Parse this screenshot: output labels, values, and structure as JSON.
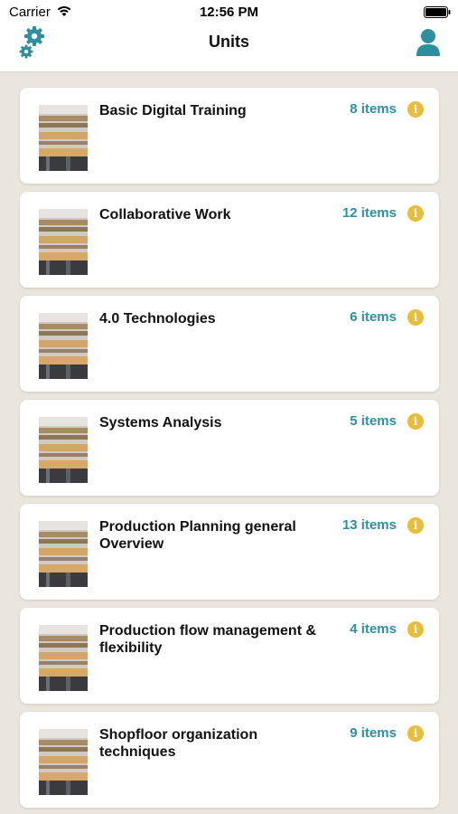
{
  "status_bar": {
    "carrier": "Carrier",
    "time": "12:56 PM"
  },
  "nav": {
    "title": "Units",
    "settings_icon": "gears-icon",
    "profile_icon": "user-icon"
  },
  "colors": {
    "accent_teal": "#2e8fa1",
    "info_yellow": "#e9bd3a",
    "background": "#ebe6dd"
  },
  "units": [
    {
      "title": "Basic Digital Training",
      "count": "8 items"
    },
    {
      "title": "Collaborative Work",
      "count": "12 items"
    },
    {
      "title": "4.0 Technologies",
      "count": "6 items"
    },
    {
      "title": "Systems Analysis",
      "count": "5 items"
    },
    {
      "title": "Production Planning general Overview",
      "count": "13 items"
    },
    {
      "title": "Production flow management & flexibility",
      "count": "4 items"
    },
    {
      "title": "Shopfloor organization techniques",
      "count": "9 items"
    }
  ]
}
